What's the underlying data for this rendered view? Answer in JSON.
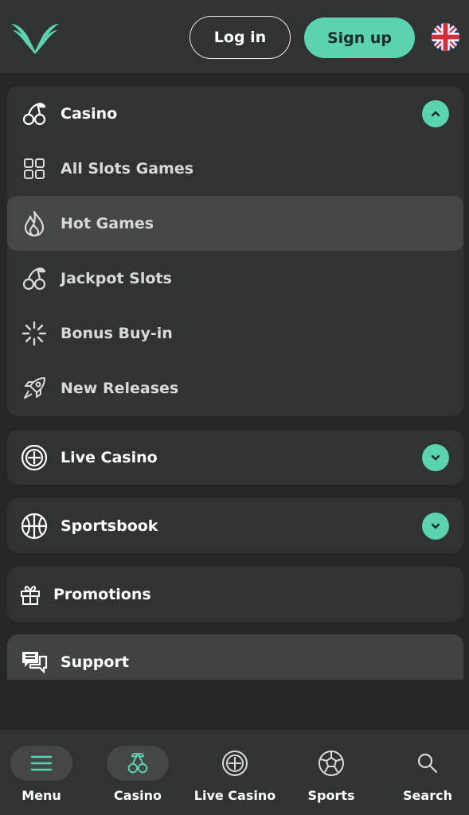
{
  "header": {
    "login_label": "Log in",
    "signup_label": "Sign up",
    "logo_icon": "bull-logo-icon",
    "language_icon": "uk-flag-icon"
  },
  "menu": {
    "casino": {
      "label": "Casino",
      "expanded": true,
      "items": [
        {
          "label": "All Slots Games",
          "icon": "grid-icon"
        },
        {
          "label": "Hot Games",
          "icon": "flame-icon",
          "active": true
        },
        {
          "label": "Jackpot Slots",
          "icon": "cherries-icon"
        },
        {
          "label": "Bonus Buy-in",
          "icon": "sparkle-icon"
        },
        {
          "label": "New Releases",
          "icon": "rocket-icon"
        }
      ]
    },
    "live_casino": {
      "label": "Live Casino",
      "expanded": false
    },
    "sportsbook": {
      "label": "Sportsbook",
      "expanded": false
    },
    "promotions": {
      "label": "Promotions"
    },
    "support": {
      "label": "Support"
    }
  },
  "bottom_nav": {
    "items": [
      {
        "label": "Menu",
        "icon": "hamburger-icon",
        "selected": true
      },
      {
        "label": "Casino",
        "icon": "cherries-icon",
        "selected": false
      },
      {
        "label": "Live Casino",
        "icon": "roulette-icon",
        "selected": false
      },
      {
        "label": "Sports",
        "icon": "soccer-ball-icon",
        "selected": false
      },
      {
        "label": "Search",
        "icon": "search-icon",
        "selected": false
      }
    ]
  },
  "colors": {
    "accent": "#5ad4b0",
    "background": "#262727",
    "card": "#313232",
    "active_row": "#454646"
  }
}
